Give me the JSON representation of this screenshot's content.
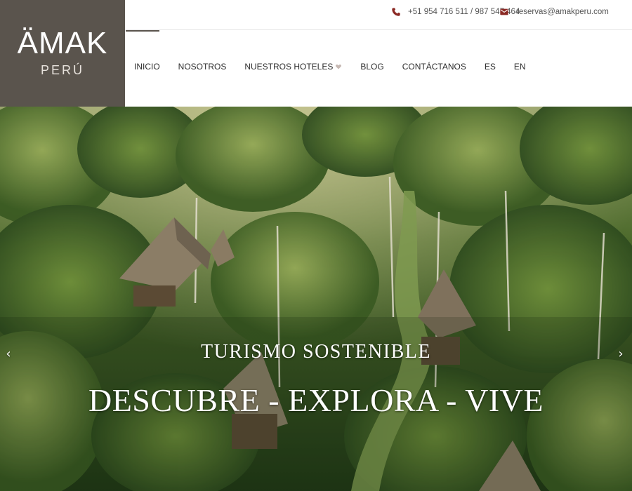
{
  "brand": {
    "name": "ÄMAK",
    "subtitle": "PERÚ"
  },
  "contact": {
    "phone_icon": "phone-icon",
    "phone": "+51 954 716 511 / 987 547 464",
    "email_icon": "envelope-icon",
    "email": "reservas@amakperu.com"
  },
  "nav": {
    "items": [
      {
        "label": "INICIO",
        "active": true
      },
      {
        "label": "NOSOTROS"
      },
      {
        "label": "NUESTROS HOTELES",
        "has_dropdown": true
      },
      {
        "label": "BLOG"
      },
      {
        "label": "CONTÁCTANOS"
      },
      {
        "label": "ES"
      },
      {
        "label": "EN"
      }
    ]
  },
  "hero": {
    "kicker": "TURISMO SOSTENIBLE",
    "headline": "DESCUBRE - EXPLORA - VIVE",
    "prev_arrow": "‹",
    "next_arrow": "›"
  },
  "colors": {
    "logo_bg": "#5a544d",
    "icon_accent": "#8b2a25",
    "nav_text": "#2d2d2d",
    "forest_dark": "#26401c",
    "forest_light": "#8fa35a"
  }
}
